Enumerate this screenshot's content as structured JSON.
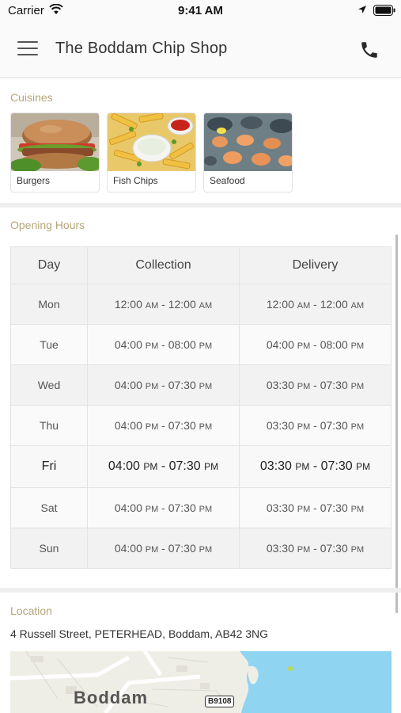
{
  "status_bar": {
    "carrier": "Carrier",
    "time": "9:41 AM"
  },
  "header": {
    "title": "The Boddam Chip Shop"
  },
  "cuisines": {
    "label": "Cuisines",
    "items": [
      {
        "label": "Burgers"
      },
      {
        "label": "Fish  Chips"
      },
      {
        "label": "Seafood"
      }
    ]
  },
  "opening_hours": {
    "label": "Opening Hours",
    "columns": [
      "Day",
      "Collection",
      "Delivery"
    ],
    "rows": [
      {
        "day": "Mon",
        "collection": {
          "start": "12:00",
          "start_ap": "AM",
          "sep": " - ",
          "end": "12:00",
          "end_ap": "AM"
        },
        "delivery": {
          "start": "12:00",
          "start_ap": "AM",
          "sep": " - ",
          "end": "12:00",
          "end_ap": "AM"
        }
      },
      {
        "day": "Tue",
        "collection": {
          "start": "04:00",
          "start_ap": "PM",
          "sep": " - ",
          "end": "08:00",
          "end_ap": "PM"
        },
        "delivery": {
          "start": "04:00",
          "start_ap": "PM",
          "sep": " - ",
          "end": "08:00",
          "end_ap": "PM"
        }
      },
      {
        "day": "Wed",
        "collection": {
          "start": "04:00",
          "start_ap": "PM",
          "sep": " - ",
          "end": "07:30",
          "end_ap": "PM"
        },
        "delivery": {
          "start": "03:30",
          "start_ap": "PM",
          "sep": " - ",
          "end": "07:30",
          "end_ap": "PM"
        }
      },
      {
        "day": "Thu",
        "collection": {
          "start": "04:00",
          "start_ap": "PM",
          "sep": " - ",
          "end": "07:30",
          "end_ap": "PM"
        },
        "delivery": {
          "start": "03:30",
          "start_ap": "PM",
          "sep": " - ",
          "end": "07:30",
          "end_ap": "PM"
        }
      },
      {
        "day": "Fri",
        "collection": {
          "start": "04:00",
          "start_ap": "PM",
          "sep": " - ",
          "end": "07:30",
          "end_ap": "PM"
        },
        "delivery": {
          "start": "03:30",
          "start_ap": "PM",
          "sep": " - ",
          "end": "07:30",
          "end_ap": "PM"
        }
      },
      {
        "day": "Sat",
        "collection": {
          "start": "04:00",
          "start_ap": "PM",
          "sep": " - ",
          "end": "07:30",
          "end_ap": "PM"
        },
        "delivery": {
          "start": "03:30",
          "start_ap": "PM",
          "sep": " - ",
          "end": "07:30",
          "end_ap": "PM"
        }
      },
      {
        "day": "Sun",
        "collection": {
          "start": "04:00",
          "start_ap": "PM",
          "sep": " - ",
          "end": "07:30",
          "end_ap": "PM"
        },
        "delivery": {
          "start": "03:30",
          "start_ap": "PM",
          "sep": " - ",
          "end": "07:30",
          "end_ap": "PM"
        }
      }
    ]
  },
  "location": {
    "label": "Location",
    "address": "4 Russell Street, PETERHEAD, Boddam, AB42 3NG",
    "map_town": "Boddam",
    "map_road": "B9108"
  },
  "icons": {
    "menu": "hamburger-menu-icon",
    "phone": "phone-icon",
    "wifi": "wifi-icon",
    "location": "location-arrow-icon",
    "battery": "battery-icon"
  },
  "colors": {
    "section_label": "#b5a679",
    "sea": "#8fd4f0",
    "land": "#efeee6"
  }
}
